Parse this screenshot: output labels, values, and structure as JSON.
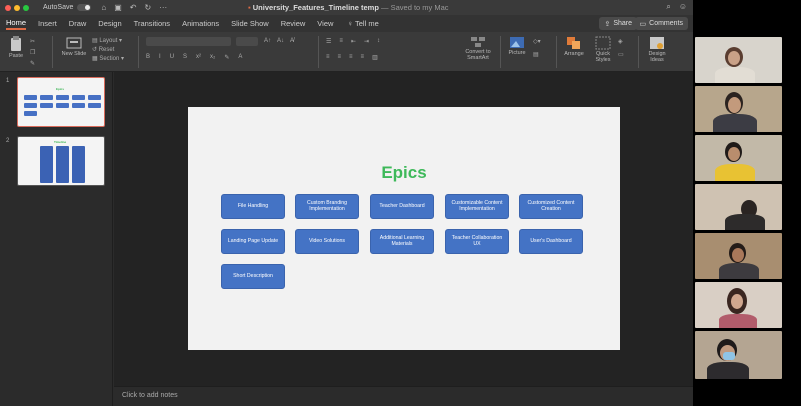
{
  "titlebar": {
    "autosave_label": "AutoSave",
    "doc_name": "University_Features_Timeline temp",
    "saved_status": "— Saved to my Mac"
  },
  "tabs": [
    "Home",
    "Insert",
    "Draw",
    "Design",
    "Transitions",
    "Animations",
    "Slide Show",
    "Review",
    "View"
  ],
  "tell_me": "Tell me",
  "share_label": "Share",
  "comments_label": "Comments",
  "ribbon": {
    "paste": "Paste",
    "new_slide": "New Slide",
    "layout": "Layout",
    "reset": "Reset",
    "section": "Section",
    "convert_smartart": "Convert to SmartArt",
    "picture": "Picture",
    "arrange": "Arrange",
    "quick_styles": "Quick Styles",
    "design_ideas": "Design Ideas"
  },
  "thumbnails": [
    "1",
    "2"
  ],
  "slide": {
    "title": "Epics",
    "epics": [
      "File Handling",
      "Custom Branding Implementation",
      "Teacher Dashboard",
      "Customizable Content Implementation",
      "Customized Content Creation",
      "Landing Page Update",
      "Video Solutions",
      "Additional Learning Materials",
      "Teacher Collaboration UX",
      "User's Dashboard",
      "Short Description"
    ]
  },
  "notes_placeholder": "Click to add notes",
  "colors": {
    "accent_green": "#3eb95a",
    "epic_blue": "#4473c5",
    "tab_underline": "#e06b45"
  }
}
